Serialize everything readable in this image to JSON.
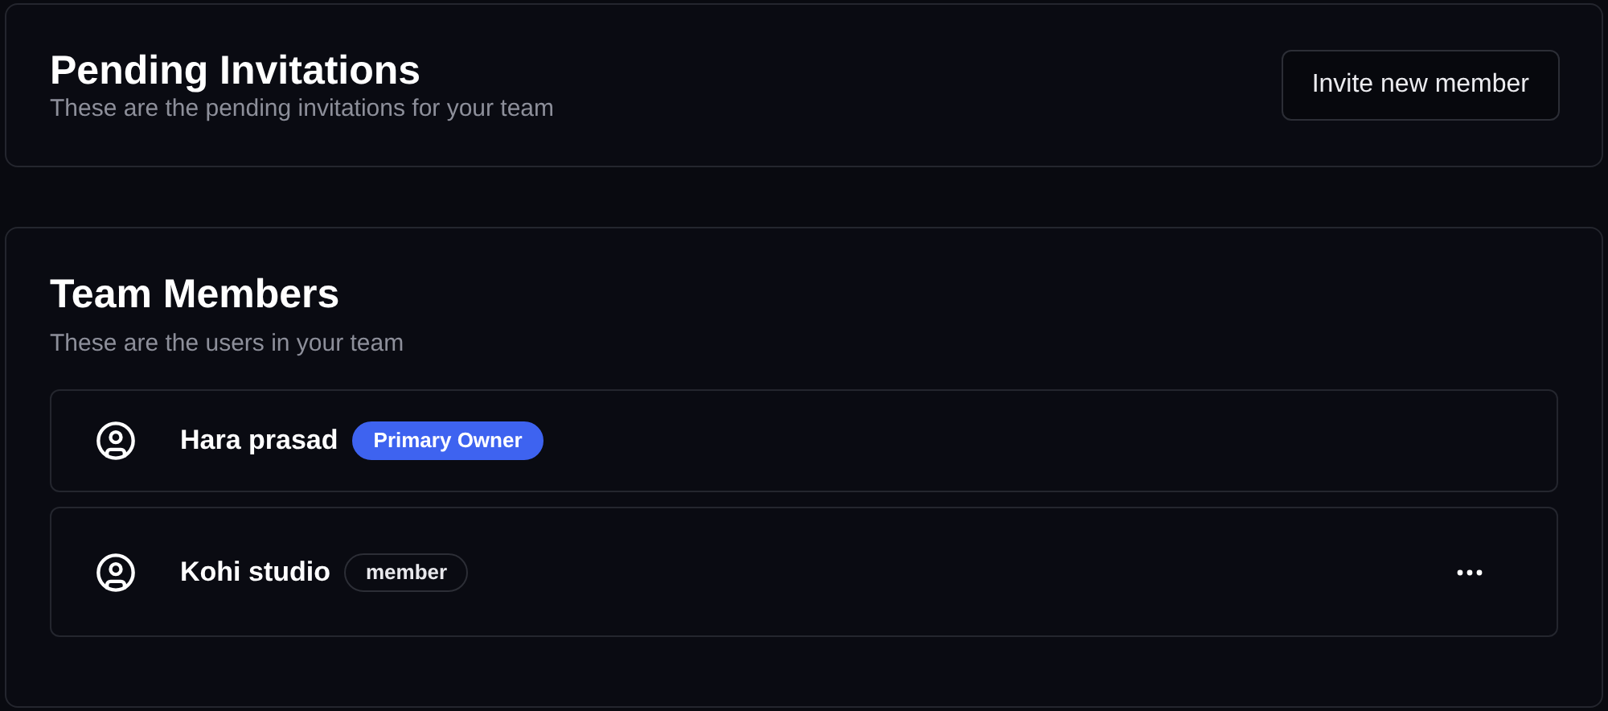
{
  "pending_invitations": {
    "title": "Pending Invitations",
    "description": "These are the pending invitations for your team",
    "invite_button": "Invite new member"
  },
  "team_members": {
    "title": "Team Members",
    "description": "These are the users in your team",
    "members": [
      {
        "name": "Hara prasad",
        "role": {
          "label": "Primary Owner",
          "kind": "primary"
        },
        "menu": false
      },
      {
        "name": "Kohi studio",
        "role": {
          "label": "member",
          "kind": "outline"
        },
        "menu": true
      }
    ]
  }
}
